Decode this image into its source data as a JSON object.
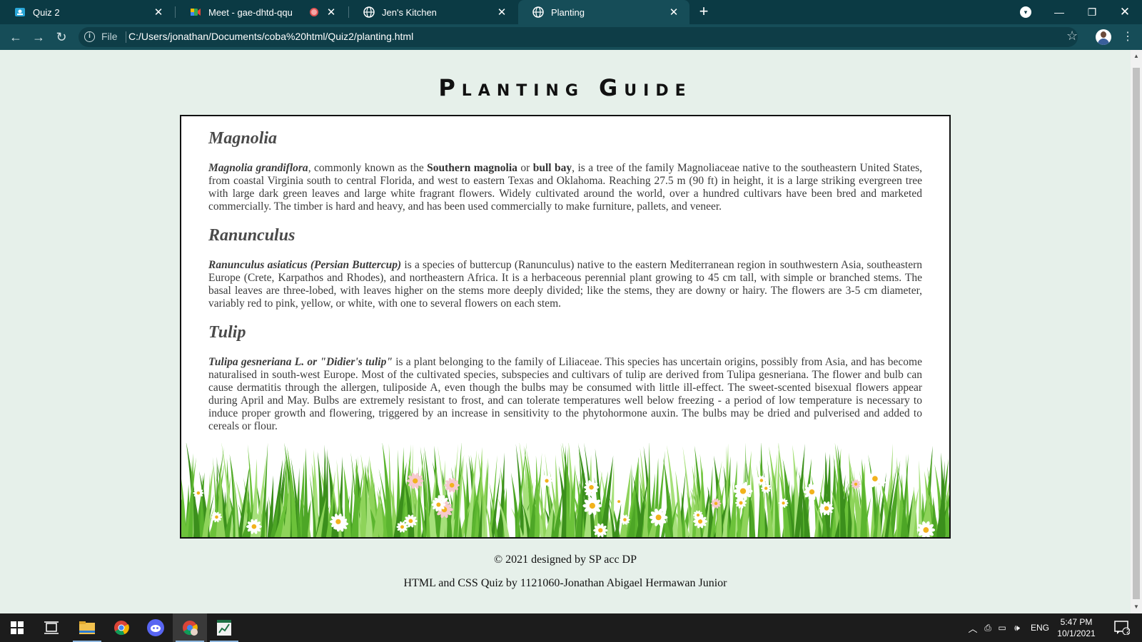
{
  "browser": {
    "tabs": [
      {
        "title": "Quiz 2",
        "icon": "classroom-icon",
        "active": false
      },
      {
        "title": "Meet - gae-dhtd-qqu",
        "icon": "meet-icon",
        "active": false,
        "recording": true
      },
      {
        "title": "Jen's Kitchen",
        "icon": "globe-icon",
        "active": false
      },
      {
        "title": "Planting",
        "icon": "globe-icon",
        "active": true
      }
    ],
    "address": {
      "scheme_chip": "File",
      "url": "C:/Users/jonathan/Documents/coba%20html/Quiz2/planting.html"
    }
  },
  "page": {
    "heading": "Planting Guide",
    "sections": [
      {
        "name": "Magnolia",
        "paragraph": {
          "lead": "Magnolia grandiflora",
          "t1": ", commonly known as the ",
          "b1": "Southern magnolia",
          "t2": " or ",
          "b2": "bull bay",
          "t3": ", is a tree of the family Magnoliaceae native to the southeastern United States, from coastal Virginia south to central Florida, and west to eastern Texas and Oklahoma. Reaching 27.5 m (90 ft) in height, it is a large striking evergreen tree with large dark green leaves and large white fragrant flowers. Widely cultivated around the world, over a hundred cultivars have been bred and marketed commercially. The timber is hard and heavy, and has been used commercially to make furniture, pallets, and veneer."
        }
      },
      {
        "name": "Ranunculus",
        "paragraph": {
          "lead": "Ranunculus asiaticus (Persian Buttercup)",
          "text": " is a species of buttercup (Ranunculus) native to the eastern Mediterranean region in southwestern Asia, southeastern Europe (Crete, Karpathos and Rhodes), and northeastern Africa. It is a herbaceous perennial plant growing to 45 cm tall, with simple or branched stems. The basal leaves are three-lobed, with leaves higher on the stems more deeply divided; like the stems, they are downy or hairy. The flowers are 3-5 cm diameter, variably red to pink, yellow, or white, with one to several flowers on each stem."
        }
      },
      {
        "name": "Tulip",
        "paragraph": {
          "lead": "Tulipa gesneriana L. or \"Didier's tulip\"",
          "text": " is a plant belonging to the family of Liliaceae. This species has uncertain origins, possibly from Asia, and has become naturalised in south-west Europe. Most of the cultivated species, subspecies and cultivars of tulip are derived from Tulipa gesneriana. The flower and bulb can cause dermatitis through the allergen, tuliposide A, even though the bulbs may be consumed with little ill-effect. The sweet-scented bisexual flowers appear during April and May. Bulbs are extremely resistant to frost, and can tolerate temperatures well below freezing - a period of low temperature is necessary to induce proper growth and flowering, triggered by an increase in sensitivity to the phytohormone auxin. The bulbs may be dried and pulverised and added to cereals or flour."
        }
      }
    ],
    "footer": {
      "credit": "© 2021 designed by SP acc DP",
      "quiz": "HTML and CSS Quiz by 1121060-Jonathan Abigael Hermawan Junior"
    }
  },
  "taskbar": {
    "apps": [
      "start-icon",
      "task-view-icon",
      "file-explorer-icon",
      "chrome-icon",
      "discord-icon",
      "chrome-profile-icon",
      "spreadsheet-icon"
    ],
    "language": "ENG",
    "time": "5:47 PM",
    "date": "10/1/2021",
    "notifications": "2"
  },
  "colors": {
    "tab_strip": "#0b3a44",
    "toolbar": "#164d58",
    "page_bg": "#e6f0ea",
    "card_border": "#111111",
    "grass_green": "#5cb82e",
    "taskbar": "#1c1c1c"
  }
}
